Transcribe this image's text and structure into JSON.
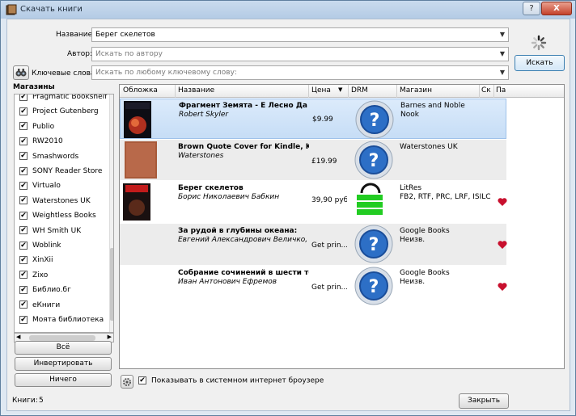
{
  "window": {
    "title": "Скачать книги",
    "help_label": "?",
    "close_label": "X"
  },
  "search": {
    "title_label": "Название:",
    "title_value": "Берег скелетов",
    "author_label": "Автор:",
    "author_placeholder": "Искать по автору",
    "keywords_label": "Ключевые слова:",
    "keywords_placeholder": "Искать по любому ключевому слову:",
    "search_button": "Искать"
  },
  "stores": {
    "heading": "Магазины",
    "items": [
      {
        "label": "Pragmatic Bookshelf",
        "checked": true
      },
      {
        "label": "Project Gutenberg",
        "checked": true
      },
      {
        "label": "Publio",
        "checked": true
      },
      {
        "label": "RW2010",
        "checked": true
      },
      {
        "label": "Smashwords",
        "checked": true
      },
      {
        "label": "SONY Reader Store",
        "checked": true
      },
      {
        "label": "Virtualo",
        "checked": true
      },
      {
        "label": "Waterstones UK",
        "checked": true
      },
      {
        "label": "Weightless Books",
        "checked": true
      },
      {
        "label": "WH Smith UK",
        "checked": true
      },
      {
        "label": "Woblink",
        "checked": true
      },
      {
        "label": "XinXii",
        "checked": true
      },
      {
        "label": "Zixo",
        "checked": true
      },
      {
        "label": "Библио.бг",
        "checked": true
      },
      {
        "label": "eКниги",
        "checked": true
      },
      {
        "label": "Моята библиотека",
        "checked": true
      }
    ],
    "all_button": "Всё",
    "invert_button": "Инвертировать",
    "none_button": "Ничего"
  },
  "results": {
    "columns": [
      "Обложка",
      "Название",
      "Цена",
      "DRM",
      "Магазин",
      "Ск",
      "Па"
    ],
    "rows": [
      {
        "title": "Фрагмент Земята - Е Лесно Да Се I",
        "author": "Robert Skyler",
        "price": "$9.99",
        "drm": "unknown",
        "store": "Barnes and Noble",
        "store2": "Nook",
        "fav": false
      },
      {
        "title": "Brown Quote Cover for Kindle, Kindle",
        "author": "Waterstones",
        "price": "£19.99",
        "drm": "unknown",
        "store": "Waterstones UK",
        "store2": "",
        "fav": false
      },
      {
        "title": "Берег скелетов",
        "author": "Борис Николаевич Бабкин",
        "price": "39,90 руб.",
        "drm": "unlocked",
        "store": "LitRes",
        "store2": "FB2, RTF, PRC, LRF, ISILC",
        "fav": true
      },
      {
        "title": "За рудой в глубины океана:",
        "author": "Евгений Александрович Величко, Евген",
        "price": "Get prin...",
        "drm": "unknown",
        "store": "Google Books",
        "store2": "Неизв.",
        "fav": true
      },
      {
        "title": "Собрание сочинений в шести томах",
        "author": "Иван Антонович Ефремов",
        "price": "Get prin...",
        "drm": "unknown",
        "store": "Google Books",
        "store2": "Неизв.",
        "fav": true
      }
    ]
  },
  "footer": {
    "browser_checkbox_label": "Показывать в системном интернет броузере",
    "browser_checked": true,
    "count_label": "Книги:",
    "count_value": "5",
    "close_button": "Закрыть"
  },
  "colors": {
    "accent": "#2d6fc6",
    "selection": "#c6ddf6",
    "heart": "#c8102e",
    "drm_unlocked": "#22cc22"
  }
}
